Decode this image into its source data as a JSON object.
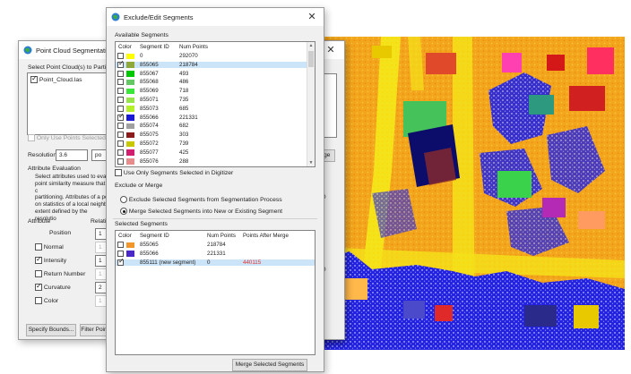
{
  "dialog_back": {
    "title": "Point Cloud Segmentation t",
    "select_label": "Select Point Cloud(s) to Partition",
    "point_clouds": [
      {
        "name": "Point_Cloud.las",
        "checked": true
      }
    ],
    "only_use_selected": "Only Use Points Selected in D",
    "resolution_label": "Resolution",
    "resolution_value": "3.6",
    "resolution_unit": "po",
    "attr_eval_label": "Attribute Evaluation",
    "attr_eval_text": [
      "Select attributes used to eval",
      "point similarity measure that c",
      "partitioning. Attributes of a pe",
      "on statistics of a local neighb",
      "extent defined by the resolutio"
    ],
    "attr_col_header": "Attribute",
    "rel_col_header": "Relativ",
    "attributes": [
      {
        "name": "Position",
        "checked": null,
        "value": "1",
        "enabled": true
      },
      {
        "name": "Normal",
        "checked": false,
        "value": "1",
        "enabled": false
      },
      {
        "name": "Intensity",
        "checked": true,
        "value": "1",
        "enabled": true
      },
      {
        "name": "Return Number",
        "checked": false,
        "value": "1",
        "enabled": false
      },
      {
        "name": "Curvature",
        "checked": true,
        "value": "2",
        "enabled": true
      },
      {
        "name": "Color",
        "checked": false,
        "value": "1",
        "enabled": false
      }
    ],
    "specify_bounds_btn": "Specify Bounds...",
    "filter_btn": "Filter Poin"
  },
  "dialog_right_fragments": {
    "nge": "nge",
    "n00a": "00",
    "n00b": "00"
  },
  "dialog_front": {
    "title": "Exclude/Edit Segments",
    "available_label": "Available Segments",
    "col_color": "Color",
    "col_segment_id": "Segment ID",
    "col_num_points": "Num Points",
    "available_segments": [
      {
        "checked": false,
        "color": "#ffff00",
        "id": "0",
        "points": "292070",
        "selected": false
      },
      {
        "checked": true,
        "color": "#8ea83a",
        "id": "855065",
        "points": "218784",
        "selected": true
      },
      {
        "checked": false,
        "color": "#00c800",
        "id": "855067",
        "points": "493",
        "selected": false
      },
      {
        "checked": false,
        "color": "#64c864",
        "id": "855068",
        "points": "486",
        "selected": false
      },
      {
        "checked": false,
        "color": "#39e639",
        "id": "855069",
        "points": "718",
        "selected": false
      },
      {
        "checked": false,
        "color": "#96e64b",
        "id": "855071",
        "points": "735",
        "selected": false
      },
      {
        "checked": false,
        "color": "#b4f028",
        "id": "855073",
        "points": "685",
        "selected": false
      },
      {
        "checked": true,
        "color": "#1a1ad6",
        "id": "855066",
        "points": "221331",
        "selected": false
      },
      {
        "checked": false,
        "color": "#a0a0a0",
        "id": "855074",
        "points": "682",
        "selected": false
      },
      {
        "checked": false,
        "color": "#8b1a1a",
        "id": "855075",
        "points": "303",
        "selected": false
      },
      {
        "checked": false,
        "color": "#c8c800",
        "id": "855072",
        "points": "739",
        "selected": false
      },
      {
        "checked": false,
        "color": "#d21e6e",
        "id": "855077",
        "points": "425",
        "selected": false
      },
      {
        "checked": false,
        "color": "#e68c8c",
        "id": "855076",
        "points": "288",
        "selected": false
      }
    ],
    "use_only_selected": "Use Only Segments Selected in Digitizer",
    "exclude_or_merge_label": "Exclude or Merge",
    "radio_exclude": "Exclude Selected Segments from Segmentation Process",
    "radio_merge": "Merge Selected Segments into New or Existing Segment",
    "merge_selected": true,
    "selected_label": "Selected Segments",
    "sel_col_color": "Color",
    "sel_col_segment_id": "Segment ID",
    "sel_col_num_points": "Num Points",
    "sel_col_points_after": "Points After Merge",
    "selected_segments": [
      {
        "checked": false,
        "color": "#f0962a",
        "id": "855065",
        "points": "218784",
        "after": "",
        "selected": false
      },
      {
        "checked": false,
        "color": "#4a28c8",
        "id": "855066",
        "points": "221331",
        "after": "",
        "selected": false
      },
      {
        "checked": true,
        "color": "",
        "id": "855111 (new segment)",
        "points": "0",
        "after": "440115",
        "selected": true
      }
    ],
    "after_color": "#e03030",
    "merge_button": "Merge Selected Segments"
  }
}
